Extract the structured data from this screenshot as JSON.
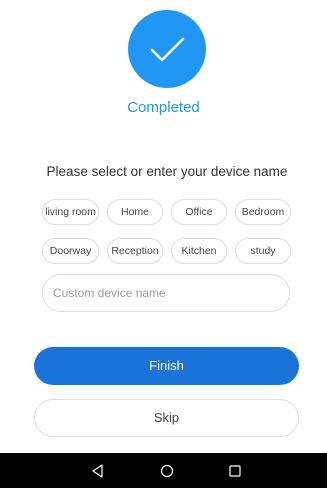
{
  "colors": {
    "accent": "#2196f3",
    "finish_button": "#1a73d9",
    "nav_bar": "#000000",
    "chip_border": "#dcdcdc"
  },
  "status": {
    "icon": "checkmark-icon",
    "label": "Completed"
  },
  "prompt": "Please select or enter your device name",
  "device_names": {
    "row1": [
      "living room",
      "Home",
      "Office",
      "Bedroom"
    ],
    "row2": [
      "Doorway",
      "Reception",
      "Kitchen",
      "study"
    ]
  },
  "custom_input": {
    "value": "",
    "placeholder": "Custom device name"
  },
  "buttons": {
    "finish": "Finish",
    "skip": "Skip"
  },
  "nav_bar": {
    "back_icon": "back-triangle-icon",
    "home_icon": "home-circle-icon",
    "recents_icon": "recents-square-icon"
  }
}
